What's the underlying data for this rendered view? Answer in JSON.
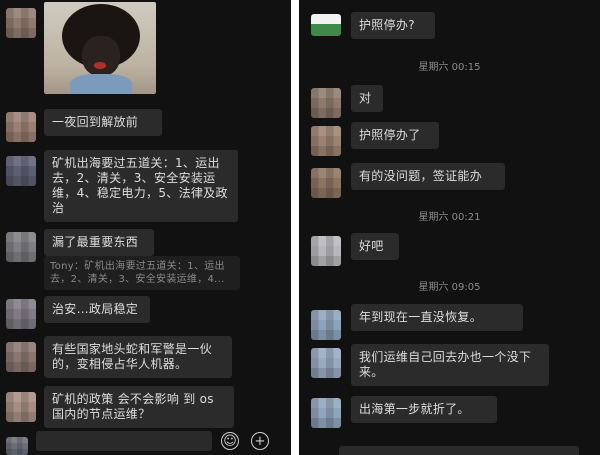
{
  "left_chat": {
    "messages": [
      {
        "text": "一夜回到解放前"
      },
      {
        "text": "矿机出海要过五道关：1、运出去，2、清关，3、安全安装运维，4、稳定电力，5、法律及政治"
      },
      {
        "text": "漏了最重要东西"
      },
      {
        "text": "Tony：矿机出海要过五道关：1、运出去，2、清关，3、安全安装运维，4..."
      },
      {
        "text": "治安…政局稳定"
      },
      {
        "text": "有些国家地头蛇和军警是一伙的，变相侵占华人机器。"
      },
      {
        "text": "矿机的政策 会不会影响 到 os 国内的节点运维？"
      }
    ],
    "emoji_button": "☺",
    "plus_button": "+"
  },
  "right_chat": {
    "messages": [
      {
        "text": "护照停办?"
      },
      {
        "timestamp": "星期六 00:15"
      },
      {
        "text": "对"
      },
      {
        "text": "护照停办了"
      },
      {
        "text": "有的没问题，签证能办"
      },
      {
        "timestamp": "星期六 00:21"
      },
      {
        "text": "好吧"
      },
      {
        "timestamp": "星期六 09:05"
      },
      {
        "text": "年到现在一直没恢复。"
      },
      {
        "text": "我们运维自己回去办也一个没下来。"
      },
      {
        "text": "出海第一步就折了。"
      }
    ]
  },
  "colors": {
    "background": "#111111",
    "bubble": "#2b2b2b",
    "text": "#dedede",
    "timestamp": "#8c8c8c"
  }
}
